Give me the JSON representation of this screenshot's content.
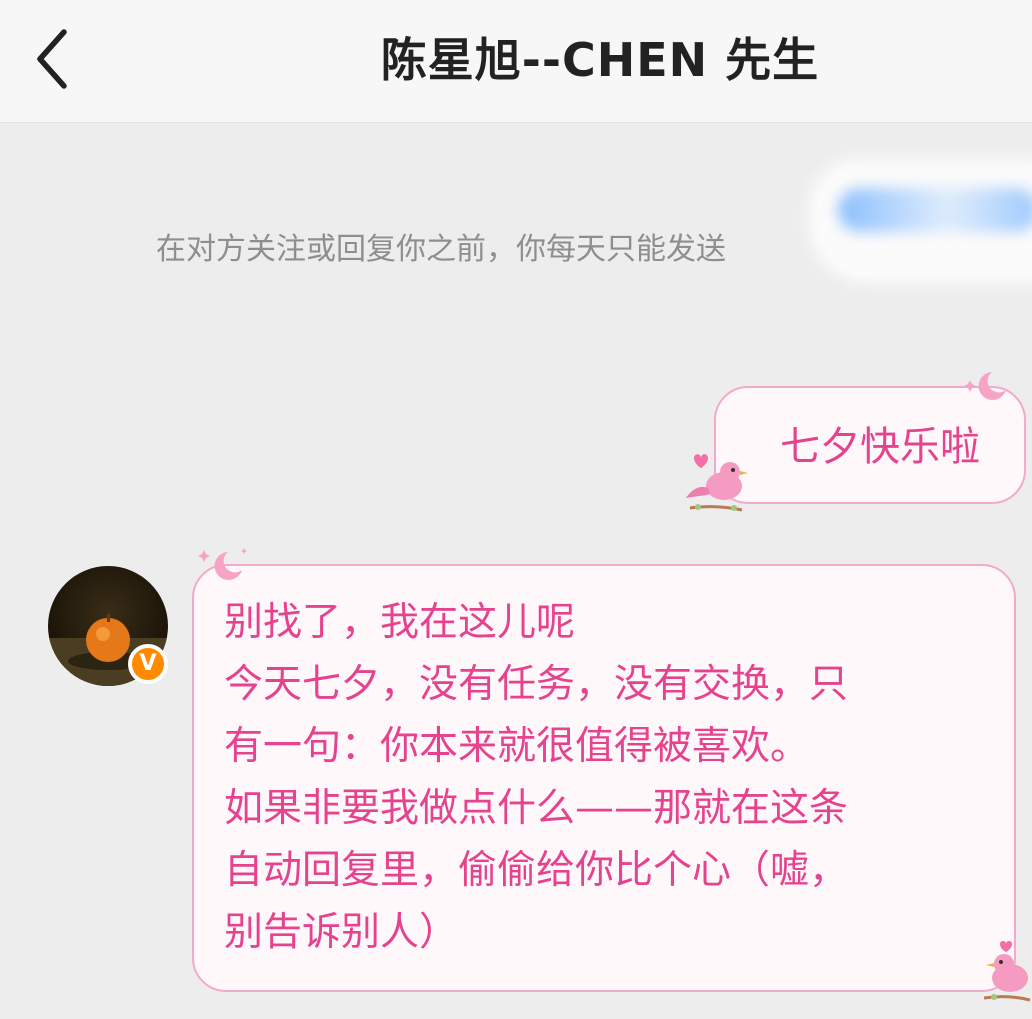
{
  "header": {
    "back_icon": "chevron-left-icon",
    "title": "陈星旭--CHEN 先生"
  },
  "notice": {
    "text": "在对方关注或回复你之前，你每天只能发送"
  },
  "messages": {
    "sent": {
      "text": "七夕快乐啦"
    },
    "received": {
      "lines": [
        "别找了，我在这儿呢",
        "今天七夕，没有任务，没有交换，只",
        "有一句：你本来就很值得被喜欢。",
        "如果非要我做点什么——那就在这条",
        "自动回复里，偷偷给你比个心（嘘，",
        "别告诉别人）"
      ]
    }
  },
  "avatar": {
    "verified_badge": "V"
  },
  "colors": {
    "bubble_text": "#e6438f",
    "bubble_border": "#f3a9cb",
    "bubble_bg": "#fff8fb",
    "badge": "#ff8a00",
    "background": "#ededed"
  },
  "icons": [
    "chevron-left-icon",
    "moon-sparkle-icon",
    "pink-bird-icon",
    "heart-icon",
    "verified-v-icon"
  ]
}
